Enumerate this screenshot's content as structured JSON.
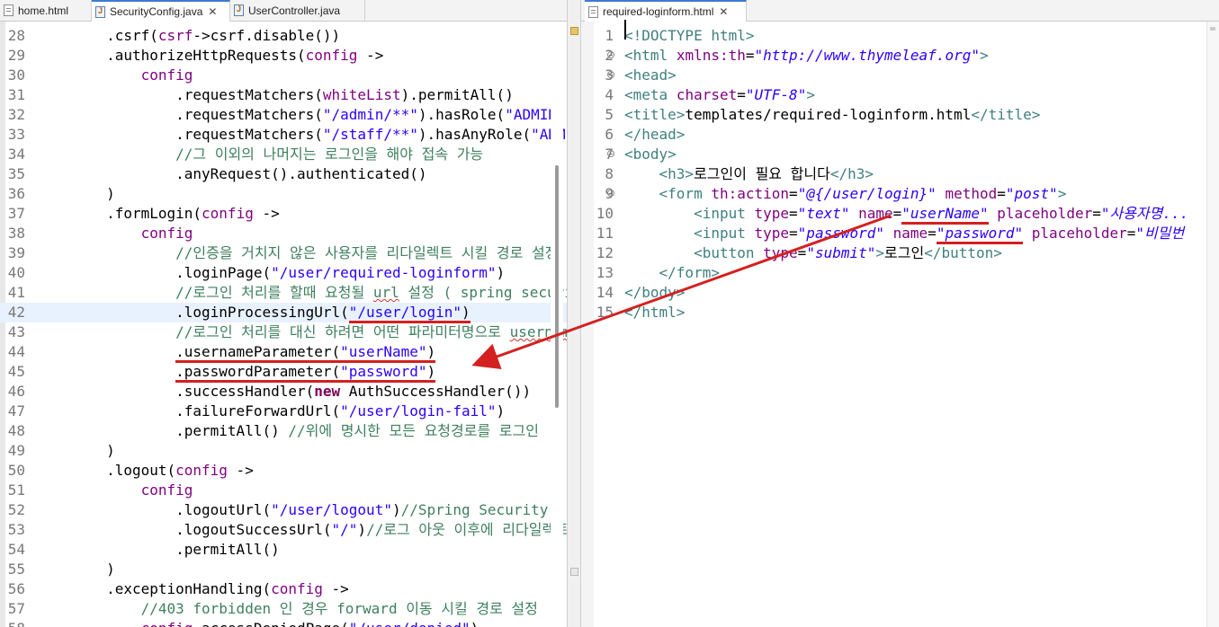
{
  "left_editor": {
    "tabs": [
      {
        "label": "home.html",
        "icon": "html-file-icon",
        "active": false
      },
      {
        "label": "SecurityConfig.java",
        "icon": "java-file-icon",
        "active": true
      },
      {
        "label": "UserController.java",
        "icon": "java-file-icon",
        "active": false
      }
    ],
    "close_glyph": "✕",
    "lines": [
      {
        "n": "28",
        "html": ".csrf(<span class=\"attr\">csrf</span>-&gt;csrf.disable())",
        "indent": 8
      },
      {
        "n": "29",
        "html": ".authorizeHttpRequests(<span class=\"attr\">config</span> -&gt;",
        "indent": 8
      },
      {
        "n": "30",
        "html": "<span class=\"attr\">config</span>",
        "indent": 12
      },
      {
        "n": "31",
        "html": ".requestMatchers(<span class=\"attr\">whiteList</span>).permitAll()",
        "indent": 16
      },
      {
        "n": "32",
        "html": ".requestMatchers(<span class=\"str\">\"/admin/**\"</span>).hasRole(<span class=\"str\">\"ADMIN\"</span>)",
        "indent": 16
      },
      {
        "n": "33",
        "html": ".requestMatchers(<span class=\"str\">\"/staff/**\"</span>).hasAnyRole(<span class=\"str\">\"ADMIN\"</span>)",
        "indent": 16
      },
      {
        "n": "34",
        "html": "<span class=\"cmt\">//그 이외의 나머지는 로그인을 해야 접속 가능</span>",
        "indent": 16
      },
      {
        "n": "35",
        "html": ".anyRequest().authenticated()",
        "indent": 16
      },
      {
        "n": "36",
        "html": ")",
        "indent": 8
      },
      {
        "n": "37",
        "html": ".formLogin(<span class=\"attr\">config</span> -&gt;",
        "indent": 8
      },
      {
        "n": "38",
        "html": "<span class=\"attr\">config</span>",
        "indent": 12
      },
      {
        "n": "39",
        "html": "<span class=\"cmt\">//인증을 거치지 않은 사용자를 리다일렉트 시킬 경로 설정</span>",
        "indent": 16
      },
      {
        "n": "40",
        "html": ".loginPage(<span class=\"str\">\"/user/required-loginform\"</span>)",
        "indent": 16
      },
      {
        "n": "41",
        "html": "<span class=\"cmt\">//로그인 처리를 할때 요청될 <span class=\"squig\">url</span> 설정 ( spring security</span>",
        "indent": 16
      },
      {
        "n": "42",
        "html": ".loginProcessingUrl(<span class=\"underline\"><span class=\"str\">\"/user/login\"</span>)</span>",
        "indent": 16,
        "hl": true
      },
      {
        "n": "43",
        "html": "<span class=\"cmt\">//로그인 처리를 대신 하려면 어떤 파라미터명으로 <span class=\"squig\">username</span></span>",
        "indent": 16
      },
      {
        "n": "44",
        "html": "<span class=\"underline\">.usernameParameter(<span class=\"str\">\"userName\"</span>)</span>",
        "indent": 16
      },
      {
        "n": "45",
        "html": "<span class=\"underline\">.passwordParameter(<span class=\"str\">\"password\"</span>)</span>",
        "indent": 16
      },
      {
        "n": "46",
        "html": ".successHandler(<span class=\"kw\">new</span> AuthSuccessHandler())",
        "indent": 16
      },
      {
        "n": "47",
        "html": ".failureForwardUrl(<span class=\"str\">\"/user/login-fail\"</span>)",
        "indent": 16
      },
      {
        "n": "48",
        "html": ".permitAll() <span class=\"cmt\">//위에 명시한 모든 요청경로를 로그인</span>",
        "indent": 16
      },
      {
        "n": "49",
        "html": ")",
        "indent": 8
      },
      {
        "n": "50",
        "html": ".logout(<span class=\"attr\">config</span> -&gt;",
        "indent": 8
      },
      {
        "n": "51",
        "html": "<span class=\"attr\">config</span>",
        "indent": 12
      },
      {
        "n": "52",
        "html": ".logoutUrl(<span class=\"str\">\"/user/logout\"</span>)<span class=\"cmt\">//Spring Security</span>",
        "indent": 16
      },
      {
        "n": "53",
        "html": ".logoutSuccessUrl(<span class=\"str\">\"/\"</span>)<span class=\"cmt\">//로그 아웃 이후에 리다일렉트</span>",
        "indent": 16
      },
      {
        "n": "54",
        "html": ".permitAll()",
        "indent": 16
      },
      {
        "n": "55",
        "html": ")",
        "indent": 8
      },
      {
        "n": "56",
        "html": ".exceptionHandling(<span class=\"attr\">config</span> -&gt;",
        "indent": 8
      },
      {
        "n": "57",
        "html": "<span class=\"cmt\">//403 forbidden 인 경우 forward 이동 시킬 경로 설정</span>",
        "indent": 12
      },
      {
        "n": "58",
        "html": "<span class=\"attr\">config</span>.accessDeniedPage(<span class=\"str\">\"/user/denied\"</span>)",
        "indent": 12
      }
    ]
  },
  "right_editor": {
    "tabs": [
      {
        "label": "required-loginform.html",
        "icon": "html-file-icon",
        "active": true
      }
    ],
    "close_glyph": "✕",
    "lines": [
      {
        "n": "1",
        "html": "<span class=\"tag\">&lt;!DOCTYPE html&gt;</span>",
        "indent": 0
      },
      {
        "n": "2",
        "html": "<span class=\"tag\">&lt;html</span> <span class=\"attr\">xmlns:th</span>=<span class=\"aval\">\"http://www.thymeleaf.org\"</span><span class=\"tag\">&gt;</span>",
        "indent": 0,
        "fold": true
      },
      {
        "n": "3",
        "html": "<span class=\"tag\">&lt;head&gt;</span>",
        "indent": 0,
        "fold": true
      },
      {
        "n": "4",
        "html": "<span class=\"tag\">&lt;meta</span> <span class=\"attr\">charset</span>=<span class=\"aval\">\"UTF-8\"</span><span class=\"tag\">&gt;</span>",
        "indent": 0
      },
      {
        "n": "5",
        "html": "<span class=\"tag\">&lt;title&gt;</span>templates/required-loginform.html<span class=\"tag\">&lt;/title&gt;</span>",
        "indent": 0
      },
      {
        "n": "6",
        "html": "<span class=\"tag\">&lt;/head&gt;</span>",
        "indent": 0
      },
      {
        "n": "7",
        "html": "<span class=\"tag\">&lt;body&gt;</span>",
        "indent": 0,
        "fold": true
      },
      {
        "n": "8",
        "html": "<span class=\"tag\">&lt;h3&gt;</span>로그인이 필요 합니다<span class=\"tag\">&lt;/h3&gt;</span>",
        "indent": 4
      },
      {
        "n": "9",
        "html": "<span class=\"tag\">&lt;form</span> <span class=\"attr\">th:action</span>=<span class=\"aval\">\"@{/user/login}\"</span> <span class=\"attr\">method</span>=<span class=\"aval\">\"post\"</span><span class=\"tag\">&gt;</span>",
        "indent": 4,
        "fold": true
      },
      {
        "n": "10",
        "html": "<span class=\"tag\">&lt;input</span> <span class=\"attr\">type</span>=<span class=\"aval\">\"text\"</span> <span class=\"attr\">name</span>=<span class=\"aval underline\">\"userName\"</span> <span class=\"attr\">placeholder</span>=<span class=\"aval\">\"사용자명...</span>",
        "indent": 8
      },
      {
        "n": "11",
        "html": "<span class=\"tag\">&lt;input</span> <span class=\"attr\">type</span>=<span class=\"aval\">\"password\"</span> <span class=\"attr\">name</span>=<span class=\"aval underline\">\"password\"</span> <span class=\"attr\">placeholder</span>=<span class=\"aval\">\"비밀번</span>",
        "indent": 8
      },
      {
        "n": "12",
        "html": "<span class=\"tag\">&lt;button</span> <span class=\"attr\">type</span>=<span class=\"aval\">\"submit\"</span><span class=\"tag\">&gt;</span>로그인<span class=\"tag\">&lt;/button&gt;</span>",
        "indent": 8
      },
      {
        "n": "13",
        "html": "<span class=\"tag\">&lt;/form&gt;</span>",
        "indent": 4
      },
      {
        "n": "14",
        "html": "<span class=\"tag\">&lt;/body&gt;</span>",
        "indent": 0
      },
      {
        "n": "15",
        "html": "<span class=\"tag\">&lt;/html&gt;</span>",
        "indent": 0
      }
    ]
  },
  "annotation": {
    "color": "#d42020"
  }
}
